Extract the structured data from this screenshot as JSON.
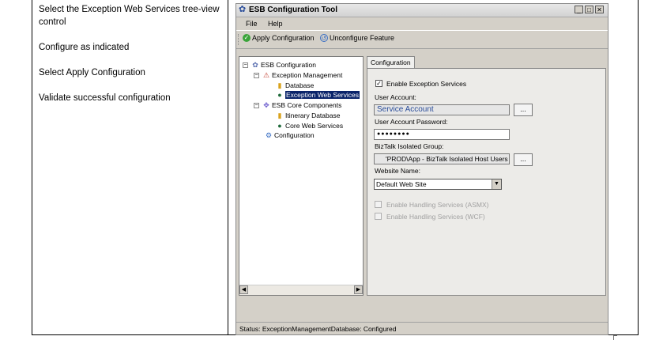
{
  "doc": {
    "steps": [
      "Select the Exception Web Services tree-view control",
      "Configure as indicated",
      "Select Apply Configuration",
      "Validate successful configuration"
    ]
  },
  "window": {
    "title": "ESB Configuration Tool",
    "menu": [
      "File",
      "Help"
    ],
    "toolbar": {
      "apply": "Apply Configuration",
      "unconfigure": "Unconfigure Feature"
    },
    "tree": {
      "root": "ESB Configuration",
      "exception_management": "Exception Management",
      "database": "Database",
      "exception_web_services": "Exception Web Services",
      "esb_core_components": "ESB Core Components",
      "itinerary_database": "Itinerary Database",
      "core_web_services": "Core Web Services",
      "configuration": "Configuration"
    },
    "panel": {
      "tab": "Configuration",
      "enable_label": "Enable Exception Services",
      "user_account_label": "User Account:",
      "user_account_value": "Service Account",
      "password_label": "User Account Password:",
      "password_value": "●●●●●●●●",
      "biztalk_group_label": "BizTalk Isolated Group:",
      "biztalk_group_value": "'PROD\\App - BizTalk Isolated Host Users",
      "website_label": "Website Name:",
      "website_value": "Default Web Site",
      "asmx_label": "Enable Handling Services (ASMX)",
      "wcf_label": "Enable Handling Services (WCF)",
      "browse": "..."
    },
    "status": "Status:  ExceptionManagementDatabase: Configured",
    "colors": {
      "selection": "#0a246a",
      "user_account_text": "#2a4d9a"
    }
  }
}
